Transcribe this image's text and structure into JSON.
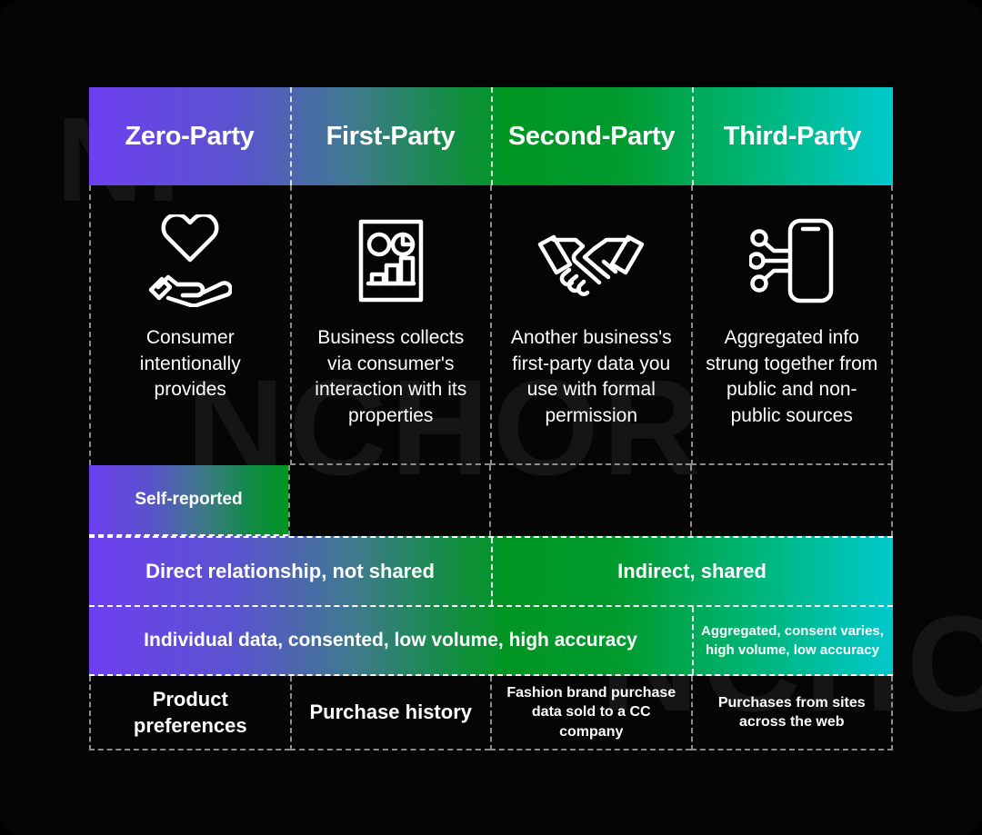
{
  "meta": {
    "background_color": "#050505",
    "accent_purple": "#6E3FF0",
    "accent_green": "#009622",
    "accent_teal": "#00C9CD",
    "divider_color": "#8D8D8D",
    "text_color": "#FFFFFF"
  },
  "watermark": {
    "line1": "NI",
    "line2": "NCHOR",
    "line3": "NCHOR"
  },
  "columns": [
    {
      "id": "zero-party",
      "title": "Zero-Party"
    },
    {
      "id": "first-party",
      "title": "First-Party"
    },
    {
      "id": "second-party",
      "title": "Second-Party"
    },
    {
      "id": "third-party",
      "title": "Third-Party"
    }
  ],
  "descriptions": [
    {
      "icon": "heart-in-hand-icon",
      "text": "Consumer intentionally provides"
    },
    {
      "icon": "analytics-report-icon",
      "text": "Business collects via consumer's interaction with its properties"
    },
    {
      "icon": "handshake-icon",
      "text": "Another business's first-party data you use with formal permission"
    },
    {
      "icon": "smartphone-data-icon",
      "text": "Aggregated info strung together from public and non-public sources"
    }
  ],
  "self_reported_row": {
    "label": "Self-reported",
    "spans_columns": 1
  },
  "relationship_row": {
    "segments": [
      {
        "label": "Direct relationship, not shared",
        "span": 2
      },
      {
        "label": "Indirect, shared",
        "span": 2
      }
    ]
  },
  "attributes_row": {
    "segments": [
      {
        "label": "Individual data, consented, low volume, high accuracy",
        "span": 3
      },
      {
        "label": "Aggregated, consent varies, high volume, low accuracy",
        "span": 1
      }
    ]
  },
  "examples_row": [
    {
      "label": "Product preferences",
      "size": "large"
    },
    {
      "label": "Purchase history",
      "size": "large"
    },
    {
      "label": "Fashion brand purchase data sold to a CC company",
      "size": "small"
    },
    {
      "label": "Purchases from sites across the web",
      "size": "small"
    }
  ]
}
